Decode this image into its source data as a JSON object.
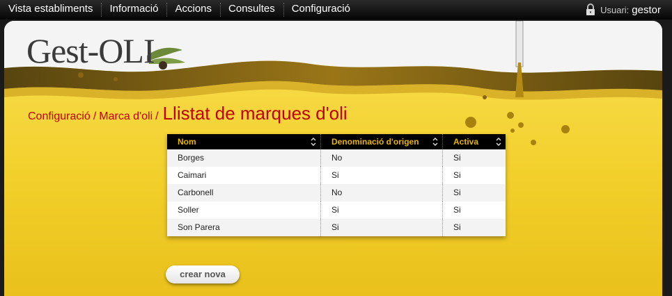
{
  "nav": {
    "items": [
      {
        "label": "Vista establiments"
      },
      {
        "label": "Informació"
      },
      {
        "label": "Accions"
      },
      {
        "label": "Consultes"
      },
      {
        "label": "Configuració"
      }
    ]
  },
  "user": {
    "label": "Usuari:",
    "name": "gestor",
    "icon": "lock-icon"
  },
  "logo": {
    "text": "Gest-OLI"
  },
  "breadcrumb": {
    "crumbs": [
      "Configuració",
      "Marca d'oli"
    ],
    "separator": "/",
    "title": "Llistat de marques d'oli"
  },
  "table": {
    "headers": [
      "Nom",
      "Denominació d'origen",
      "Activa"
    ],
    "rows": [
      [
        "Borges",
        "No",
        "Si"
      ],
      [
        "Caimari",
        "Si",
        "Si"
      ],
      [
        "Carbonell",
        "No",
        "Si"
      ],
      [
        "Soller",
        "Si",
        "Si"
      ],
      [
        "Son Parera",
        "Si",
        "Si"
      ]
    ]
  },
  "actions": {
    "create_label": "crear nova"
  },
  "colors": {
    "accent_red": "#c00000",
    "oil_yellow": "#f2cf2a",
    "header_gold": "#e8b400",
    "nav_black": "#080808"
  }
}
